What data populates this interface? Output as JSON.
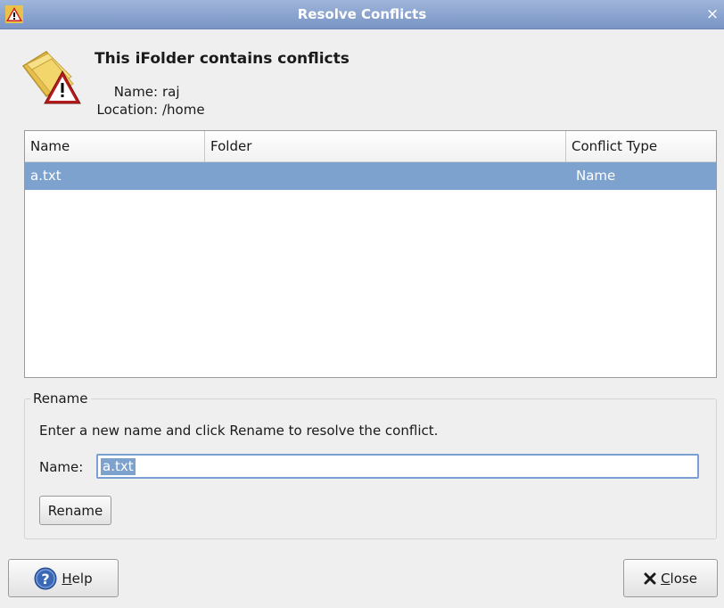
{
  "window": {
    "title": "Resolve Conflicts",
    "close_glyph": "×",
    "app_icon": "warning-icon"
  },
  "header": {
    "title": "This iFolder contains conflicts",
    "icon": "folder-warning-icon",
    "name_label": "Name:",
    "name_value": "raj",
    "location_label": "Location:",
    "location_value": "/home"
  },
  "table": {
    "columns": [
      "Name",
      "Folder",
      "Conflict Type"
    ],
    "rows": [
      {
        "name": "a.txt",
        "folder": "",
        "conflict_type": "Name",
        "selected": true
      }
    ]
  },
  "rename": {
    "legend": "Rename",
    "instruction": "Enter a new name and click Rename to resolve the conflict.",
    "name_label": "Name:",
    "name_value": "a.txt",
    "button_label": "Rename"
  },
  "footer": {
    "help_label": "Help",
    "help_mnemonic": "H",
    "help_rest": "elp",
    "close_label": "Close",
    "close_mnemonic": "C",
    "close_rest": "lose",
    "help_icon": "help-icon",
    "close_icon": "close-x-icon"
  },
  "colors": {
    "titlebar": "#8aa6d4",
    "selection": "#7da2ce",
    "warning_red": "#c02020",
    "folder_yellow": "#f2d46a"
  }
}
